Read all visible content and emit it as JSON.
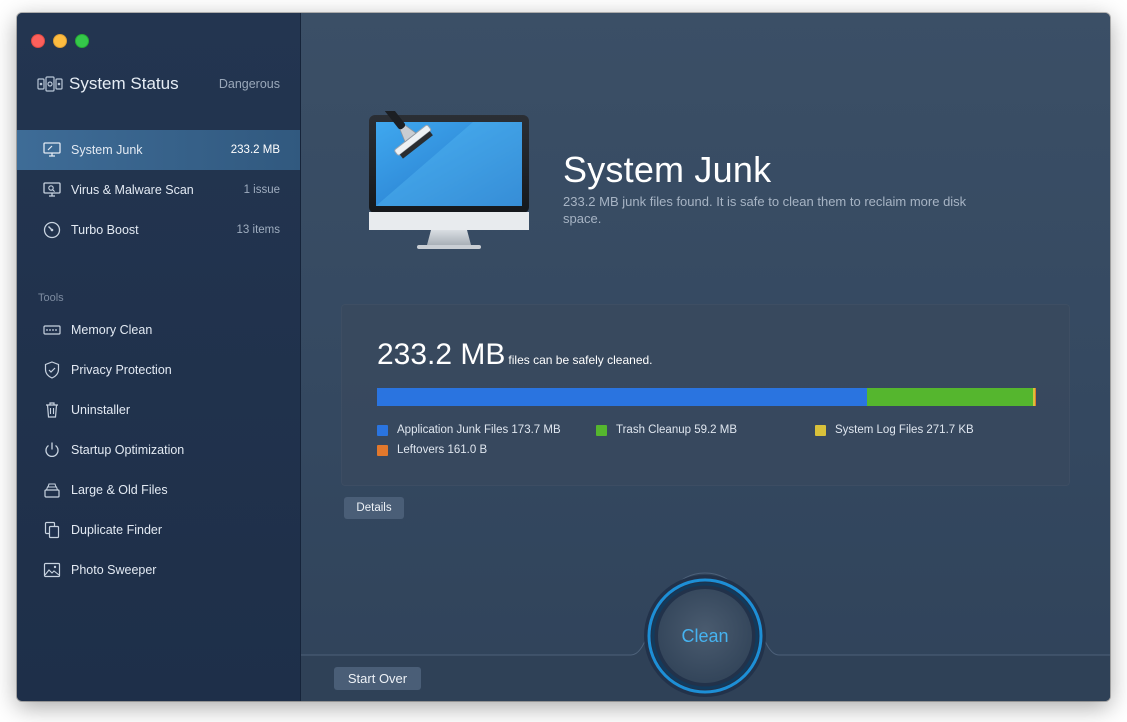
{
  "window": {
    "traffic_lights": [
      "close",
      "minimize",
      "zoom"
    ]
  },
  "sidebar": {
    "status": {
      "icon": "system-status-icon",
      "title": "System Status",
      "state": "Dangerous"
    },
    "main_items": [
      {
        "icon": "monitor-icon",
        "label": "System Junk",
        "value": "233.2 MB",
        "active": true
      },
      {
        "icon": "virus-scan-icon",
        "label": "Virus & Malware Scan",
        "value": "1 issue",
        "active": false
      },
      {
        "icon": "speedometer-icon",
        "label": "Turbo Boost",
        "value": "13 items",
        "active": false
      }
    ],
    "tools_header": "Tools",
    "tools": [
      {
        "icon": "memory-chip-icon",
        "label": "Memory Clean"
      },
      {
        "icon": "shield-icon",
        "label": "Privacy Protection"
      },
      {
        "icon": "trash-icon",
        "label": "Uninstaller"
      },
      {
        "icon": "power-icon",
        "label": "Startup Optimization"
      },
      {
        "icon": "file-stack-icon",
        "label": "Large & Old Files"
      },
      {
        "icon": "duplicate-icon",
        "label": "Duplicate Finder"
      },
      {
        "icon": "photo-icon",
        "label": "Photo Sweeper"
      }
    ]
  },
  "main": {
    "title": "System Junk",
    "description": "233.2 MB junk files found.  It is safe to clean them to reclaim more disk space.",
    "summary": {
      "size": "233.2 MB",
      "suffix": "files can be safely cleaned."
    },
    "breakdown": [
      {
        "label": "Application Junk Files 173.7 MB",
        "color": "#2a74e0",
        "fraction": 0.7429
      },
      {
        "label": "Trash Cleanup 59.2 MB",
        "color": "#55b62e",
        "fraction": 0.2527
      },
      {
        "label": "System Log Files 271.7 KB",
        "color": "#d8c13a",
        "fraction": 0.0022
      },
      {
        "label": "Leftovers 161.0 B",
        "color": "#e2782c",
        "fraction": 0.0022
      }
    ],
    "details_label": "Details",
    "clean_label": "Clean",
    "start_over_label": "Start Over"
  },
  "colors": {
    "accent": "#46b3f0",
    "sidebar_active": "#3e6c97"
  }
}
